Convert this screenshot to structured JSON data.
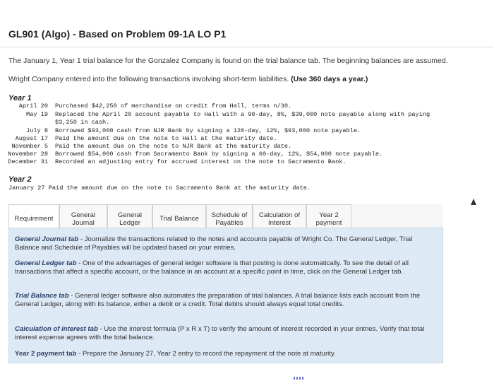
{
  "header": {
    "title": "GL901 (Algo) - Based on Problem 09-1A LO P1"
  },
  "intro": {
    "line1": "The January 1, Year 1 trial balance for the Gonzalez Company is found on the trial balance tab. The beginning balances are assumed.",
    "line2_text": "Wright Company entered into the following transactions involving short-term liabilities.",
    "line2_bold": "(Use 360 days a year.)"
  },
  "year1": {
    "heading": "Year 1",
    "transactions": [
      {
        "date": "April 20",
        "text": "Purchased $42,250 of merchandise on credit from Hall, terms n/30."
      },
      {
        "date": "May 19",
        "text": "Replaced the April 20 account payable to Hall with a 90-day, 8%, $39,000 note payable along with paying"
      },
      {
        "date": "",
        "text": "$3,250 in cash."
      },
      {
        "date": "July 8",
        "text": "Borrowed $93,000 cash from NJR Bank by signing a 120-day, 12%, $93,000 note payable."
      },
      {
        "date": "August 17",
        "text": "Paid the amount due on the note to Hall at the maturity date."
      },
      {
        "date": "November 5",
        "text": "Paid the amount due on the note to NJR Bank at the maturity date."
      },
      {
        "date": "November 28",
        "text": "Borrowed $54,000 cash from Sacramento Bank by signing a 60-day, 12%, $54,000 note payable."
      },
      {
        "date": "December 31",
        "text": "Recorded an adjusting entry for accrued interest on the note to Sacramento Bank."
      }
    ]
  },
  "year2": {
    "heading": "Year 2",
    "transaction": "January 27 Paid the amount due on the note to Sacramento Bank at the maturity date."
  },
  "tabs": [
    {
      "label": "Requirement"
    },
    {
      "label": "General Journal"
    },
    {
      "label": "General Ledger"
    },
    {
      "label": "Trial Balance"
    },
    {
      "label": "Schedule of Payables"
    },
    {
      "label": "Calculation of Interest"
    },
    {
      "label": "Year 2 payment"
    }
  ],
  "requirements": {
    "p1_title": "General Journal tab",
    "p1_text": " - Journalize the transactions related to the notes and accounts payable of Wright Co. The General Ledger, Trial Balance and Schedule of Payables will be updated based on your entries.",
    "p2_title": "General Ledger tab",
    "p2_text": " - One of the advantages of general ledger software is that posting is done automatically. To see the detail of all transactions that affect a specific account, or the balance in an account at a specific point in time, click on the General Ledger tab.",
    "p3_title": "Trial Balance tab",
    "p3_text": " - General ledger software also automates the preparation of trial balances. A trial balance lists each account from the General Ledger, along with its balance, either a debit or a credit. Total debits should always equal total credits.",
    "p4_title": "Calculation of interest tab",
    "p4_text": " - Use the interest formula (P x R x T) to verify the amount of interest recorded in your entries. Verify that total interest expense agrees with the total balance.",
    "p5_title": "Year 2 payment tab",
    "p5_text": " - Prepare the January 27, Year 2 entry to record the repayment of the note at maturity."
  }
}
